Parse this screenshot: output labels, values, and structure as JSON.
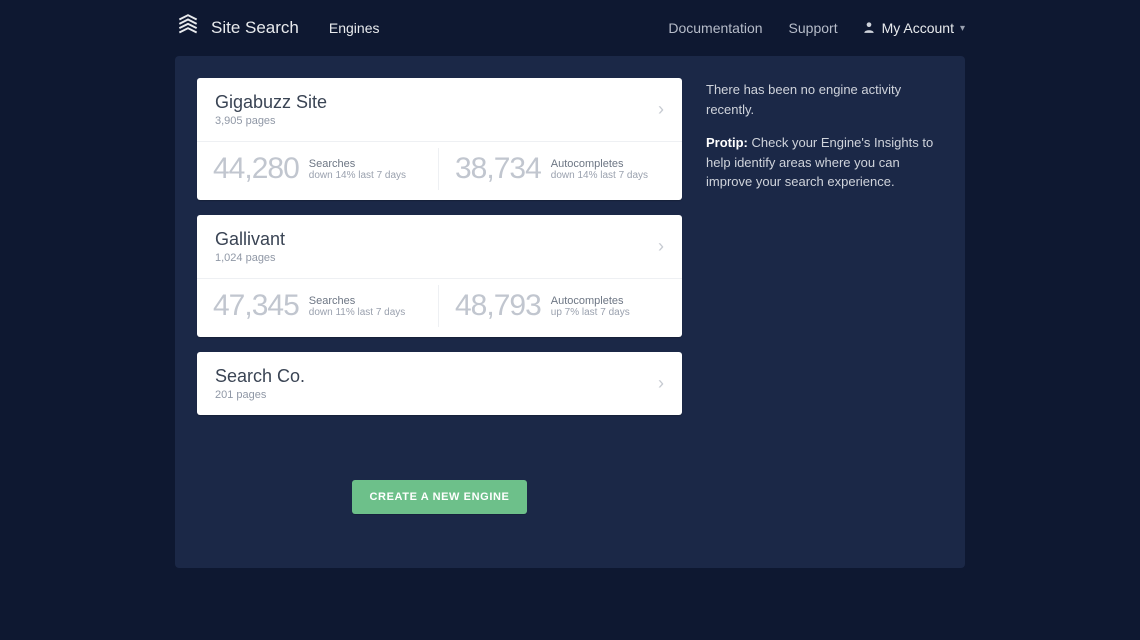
{
  "brand": "Site Search",
  "nav": {
    "engines": "Engines",
    "documentation": "Documentation",
    "support": "Support",
    "account": "My Account"
  },
  "side": {
    "no_activity": "There has been no engine activity recently.",
    "protip_label": "Protip:",
    "protip_text": "Check your Engine's Insights to help identify areas where you can improve your search experience."
  },
  "engines": [
    {
      "name": "Gigabuzz Site",
      "pages": "3,905 pages",
      "stats": [
        {
          "value": "44,280",
          "label": "Searches",
          "trend": "down 14% last 7 days"
        },
        {
          "value": "38,734",
          "label": "Autocompletes",
          "trend": "down 14% last 7 days"
        }
      ]
    },
    {
      "name": "Gallivant",
      "pages": "1,024 pages",
      "stats": [
        {
          "value": "47,345",
          "label": "Searches",
          "trend": "down 11% last 7 days"
        },
        {
          "value": "48,793",
          "label": "Autocompletes",
          "trend": "up 7% last 7 days"
        }
      ]
    },
    {
      "name": "Search Co.",
      "pages": "201 pages",
      "stats": []
    }
  ],
  "create_label": "CREATE A NEW ENGINE"
}
